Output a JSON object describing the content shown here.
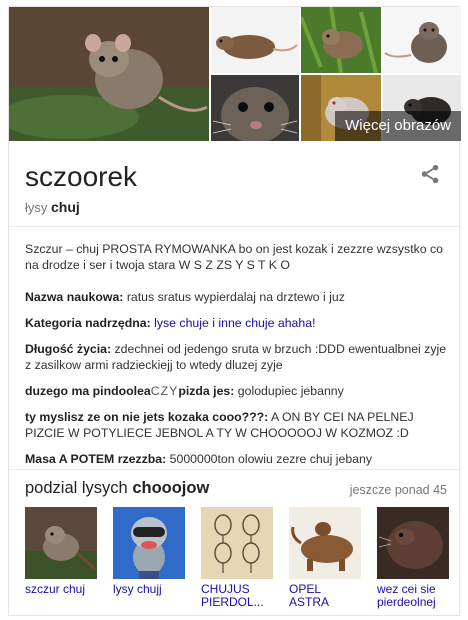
{
  "gallery": {
    "more_label": "Więcej obrazów"
  },
  "header": {
    "title": "sczoorek",
    "subtitle_prefix": "łysy",
    "subtitle_bold": "chuj"
  },
  "description": "Szczur – chuj PROSTA RYMOWANKA bo on jest kozak i zezzre wzsystko co na drodze i ser i twoja stara W S Z ZS Y S T K O",
  "facts": [
    {
      "key": "Nazwa naukowa:",
      "value": " ratus sratus wypierdalaj na drztewo i juz"
    },
    {
      "key": "Kategoria nadrzędna:",
      "value": " lyse chuje i inne chuje ahaha!"
    },
    {
      "key": "Długość życia:",
      "value": " zdechnei od jedengo sruta w brzuch :DDD ewentualbnei zyje z zasilkow armi radzieckiejj to wtedy dluzej zyje"
    },
    {
      "key": "duzego ma pindoolea",
      "key_tail": "CZY",
      "key_end": "pizda jes:",
      "value": " golodupiec jebanny"
    },
    {
      "key": "ty myslisz ze on nie jets kozaka cooo???:",
      "value": " A ON BY CEI NA PELNEJ PIZCIE W POTYLIECE JEBNOL A TY W CHOOOOOJ W KOZMOZ :D"
    },
    {
      "key": "Masa A POTEM rzezzba:",
      "value": " 5000000ton olowiu zezre chuj jebany"
    }
  ],
  "related_section": {
    "title_prefix": "podzial lysych",
    "title_bold": "chooojow",
    "more": "jeszcze ponad 45"
  },
  "related": [
    {
      "caption": "szczur chuj"
    },
    {
      "caption": "lysy chujj"
    },
    {
      "caption": "CHUJUS PIERDOL..."
    },
    {
      "caption": "OPEL ASTRA"
    },
    {
      "caption": "wez cei sie pierdeolnej"
    }
  ],
  "colors": {
    "link": "#1a0dab",
    "muted": "#777777",
    "text": "#222222"
  }
}
